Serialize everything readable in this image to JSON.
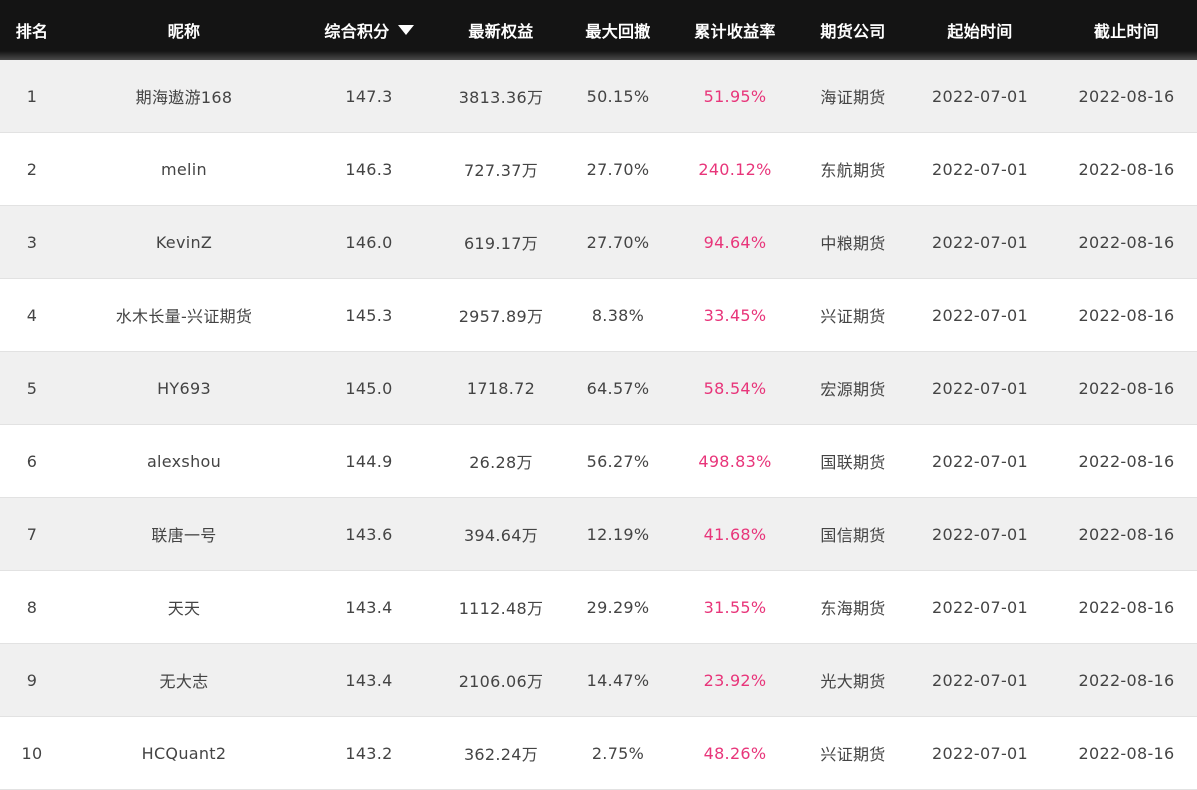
{
  "colors": {
    "header_bg": "#141414",
    "odd_row_bg": "#f0f0f0",
    "return_color": "#e8357a",
    "text": "#444444"
  },
  "header": {
    "rank": "排名",
    "nickname": "昵称",
    "score": "综合积分",
    "sort_icon": "triangle-down-icon",
    "equity": "最新权益",
    "drawdown": "最大回撤",
    "return": "累计收益率",
    "company": "期货公司",
    "start": "起始时间",
    "end": "截止时间"
  },
  "rows": [
    {
      "rank": "1",
      "nickname": "期海遨游168",
      "score": "147.3",
      "equity": "3813.36万",
      "drawdown": "50.15%",
      "return": "51.95%",
      "company": "海证期货",
      "start": "2022-07-01",
      "end": "2022-08-16"
    },
    {
      "rank": "2",
      "nickname": "melin",
      "score": "146.3",
      "equity": "727.37万",
      "drawdown": "27.70%",
      "return": "240.12%",
      "company": "东航期货",
      "start": "2022-07-01",
      "end": "2022-08-16"
    },
    {
      "rank": "3",
      "nickname": "KevinZ",
      "score": "146.0",
      "equity": "619.17万",
      "drawdown": "27.70%",
      "return": "94.64%",
      "company": "中粮期货",
      "start": "2022-07-01",
      "end": "2022-08-16"
    },
    {
      "rank": "4",
      "nickname": "水木长量-兴证期货",
      "score": "145.3",
      "equity": "2957.89万",
      "drawdown": "8.38%",
      "return": "33.45%",
      "company": "兴证期货",
      "start": "2022-07-01",
      "end": "2022-08-16"
    },
    {
      "rank": "5",
      "nickname": "HY693",
      "score": "145.0",
      "equity": "1718.72",
      "drawdown": "64.57%",
      "return": "58.54%",
      "company": "宏源期货",
      "start": "2022-07-01",
      "end": "2022-08-16"
    },
    {
      "rank": "6",
      "nickname": "alexshou",
      "score": "144.9",
      "equity": "26.28万",
      "drawdown": "56.27%",
      "return": "498.83%",
      "company": "国联期货",
      "start": "2022-07-01",
      "end": "2022-08-16"
    },
    {
      "rank": "7",
      "nickname": "联唐一号",
      "score": "143.6",
      "equity": "394.64万",
      "drawdown": "12.19%",
      "return": "41.68%",
      "company": "国信期货",
      "start": "2022-07-01",
      "end": "2022-08-16"
    },
    {
      "rank": "8",
      "nickname": "天天",
      "score": "143.4",
      "equity": "1112.48万",
      "drawdown": "29.29%",
      "return": "31.55%",
      "company": "东海期货",
      "start": "2022-07-01",
      "end": "2022-08-16"
    },
    {
      "rank": "9",
      "nickname": "无大志",
      "score": "143.4",
      "equity": "2106.06万",
      "drawdown": "14.47%",
      "return": "23.92%",
      "company": "光大期货",
      "start": "2022-07-01",
      "end": "2022-08-16"
    },
    {
      "rank": "10",
      "nickname": "HCQuant2",
      "score": "143.2",
      "equity": "362.24万",
      "drawdown": "2.75%",
      "return": "48.26%",
      "company": "兴证期货",
      "start": "2022-07-01",
      "end": "2022-08-16"
    }
  ]
}
